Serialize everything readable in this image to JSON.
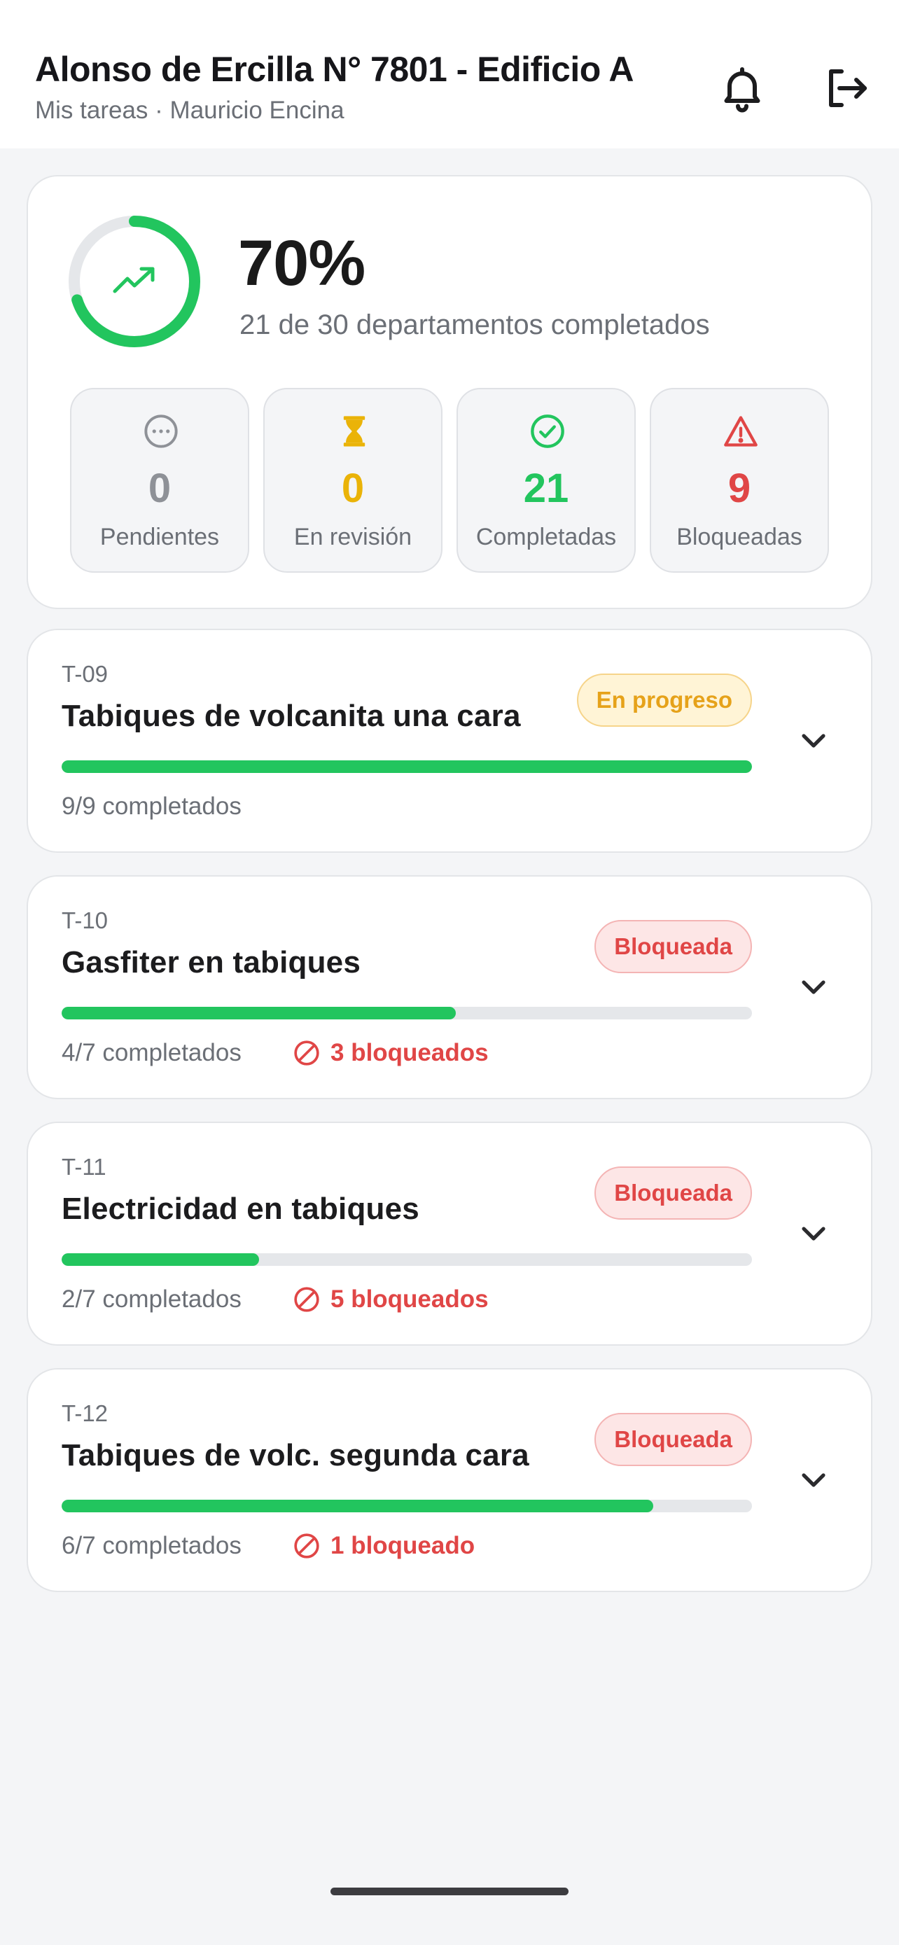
{
  "header": {
    "title": "Alonso de Ercilla N° 7801 - Edificio A",
    "subtitle": "Mis tareas · Mauricio Encina",
    "icons": [
      "bell-icon",
      "logout-icon"
    ]
  },
  "summary": {
    "percent_text": "70%",
    "percent_value": 70,
    "caption": "21 de 30 departamentos completados",
    "stats": [
      {
        "value": "0",
        "label": "Pendientes",
        "icon": "dots-circle-icon",
        "color": "#8e9197"
      },
      {
        "value": "0",
        "label": "En revisión",
        "icon": "hourglass-icon",
        "color": "#eab308"
      },
      {
        "value": "21",
        "label": "Completadas",
        "icon": "check-circle-icon",
        "color": "#22c55e"
      },
      {
        "value": "9",
        "label": "Bloqueadas",
        "icon": "warning-icon",
        "color": "#e04646"
      }
    ]
  },
  "tasks": [
    {
      "code": "T-09",
      "name": "Tabiques de volcanita una cara",
      "status": "En progreso",
      "status_kind": "progress",
      "done_text": "9/9 completados",
      "progress": 1.0,
      "blocked_text": ""
    },
    {
      "code": "T-10",
      "name": "Gasfiter en tabiques",
      "status": "Bloqueada",
      "status_kind": "blocked",
      "done_text": "4/7 completados",
      "progress": 0.5714,
      "blocked_text": "3 bloqueados"
    },
    {
      "code": "T-11",
      "name": "Electricidad en tabiques",
      "status": "Bloqueada",
      "status_kind": "blocked",
      "done_text": "2/7 completados",
      "progress": 0.2857,
      "blocked_text": "5 bloqueados"
    },
    {
      "code": "T-12",
      "name": "Tabiques de volc. segunda cara",
      "status": "Bloqueada",
      "status_kind": "blocked",
      "done_text": "6/7 completados",
      "progress": 0.8571,
      "blocked_text": "1 bloqueado"
    }
  ],
  "colors": {
    "accent_green": "#22c55e",
    "blocked_red": "#e04646",
    "progress_amber": "#e6a21a"
  }
}
